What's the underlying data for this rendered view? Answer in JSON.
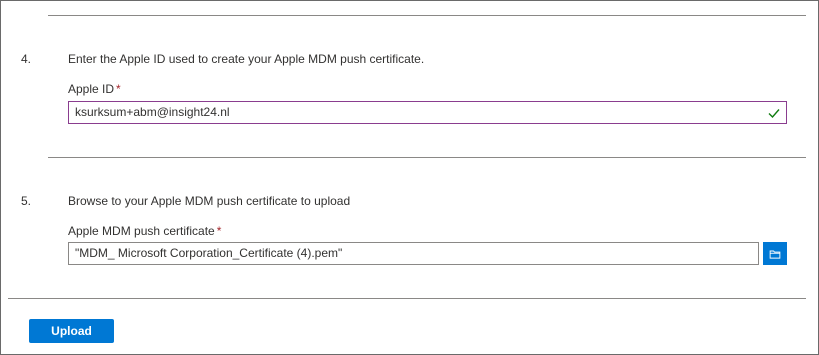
{
  "colors": {
    "accent": "#0078d4",
    "required_star": "#a4262c",
    "valid_border": "#8a3d8f",
    "valid_check": "#107c10"
  },
  "step4": {
    "number": "4.",
    "instruction": "Enter the Apple ID used to create your Apple MDM push certificate.",
    "field_label": "Apple ID",
    "required_mark": "*",
    "input_value": "ksurksum+abm@insight24.nl",
    "status_icon": "checkmark-icon"
  },
  "step5": {
    "number": "5.",
    "instruction": "Browse to your Apple MDM push certificate to upload",
    "field_label": "Apple MDM push certificate",
    "required_mark": "*",
    "file_value": "\"MDM_ Microsoft Corporation_Certificate (4).pem\"",
    "browse_icon": "folder-icon"
  },
  "footer": {
    "upload_label": "Upload"
  }
}
